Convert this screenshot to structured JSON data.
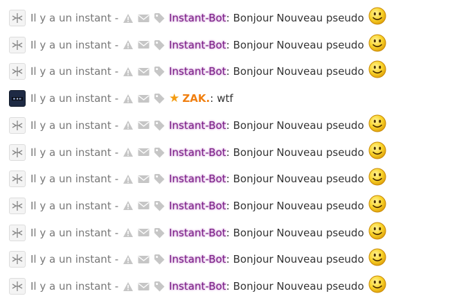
{
  "messages": [
    {
      "type": "bot",
      "time": "Il y a un instant",
      "separator": "-",
      "author": "Instant-Bot",
      "text": "Bonjour Nouveau pseudo",
      "emoji": "smiley"
    },
    {
      "type": "bot",
      "time": "Il y a un instant",
      "separator": "-",
      "author": "Instant-Bot",
      "text": "Bonjour Nouveau pseudo",
      "emoji": "smiley"
    },
    {
      "type": "bot",
      "time": "Il y a un instant",
      "separator": "-",
      "author": "Instant-Bot",
      "text": "Bonjour Nouveau pseudo",
      "emoji": "smiley"
    },
    {
      "type": "user",
      "time": "Il y a un instant",
      "separator": "-",
      "author": "ZAK.",
      "text": "wtf",
      "badge": "star-icon"
    },
    {
      "type": "bot",
      "time": "Il y a un instant",
      "separator": "-",
      "author": "Instant-Bot",
      "text": "Bonjour Nouveau pseudo",
      "emoji": "smiley"
    },
    {
      "type": "bot",
      "time": "Il y a un instant",
      "separator": "-",
      "author": "Instant-Bot",
      "text": "Bonjour Nouveau pseudo",
      "emoji": "smiley"
    },
    {
      "type": "bot",
      "time": "Il y a un instant",
      "separator": "-",
      "author": "Instant-Bot",
      "text": "Bonjour Nouveau pseudo",
      "emoji": "smiley"
    },
    {
      "type": "bot",
      "time": "Il y a un instant",
      "separator": "-",
      "author": "Instant-Bot",
      "text": "Bonjour Nouveau pseudo",
      "emoji": "smiley"
    },
    {
      "type": "bot",
      "time": "Il y a un instant",
      "separator": "-",
      "author": "Instant-Bot",
      "text": "Bonjour Nouveau pseudo",
      "emoji": "smiley"
    },
    {
      "type": "bot",
      "time": "Il y a un instant",
      "separator": "-",
      "author": "Instant-Bot",
      "text": "Bonjour Nouveau pseudo",
      "emoji": "smiley"
    },
    {
      "type": "bot",
      "time": "Il y a un instant",
      "separator": "-",
      "author": "Instant-Bot",
      "text": "Bonjour Nouveau pseudo",
      "emoji": "smiley"
    }
  ],
  "icons": [
    "warning-icon",
    "envelope-icon",
    "tag-icon",
    "star-icon",
    "smiley-icon"
  ],
  "colors": {
    "bot_author": "#7b1e86",
    "bot_glow": "#d5a7dc",
    "user_author": "#f07f10",
    "star": "#f39c12",
    "action_icon": "#c6c6c6",
    "time_text": "#777777"
  }
}
